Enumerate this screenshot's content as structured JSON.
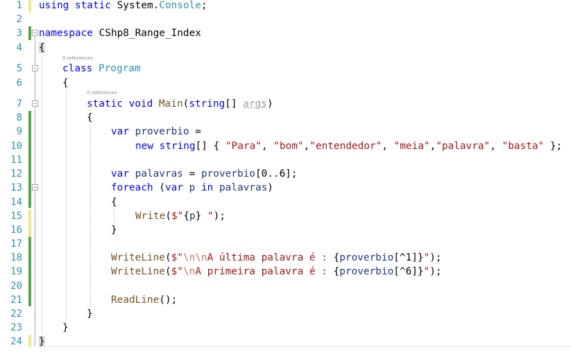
{
  "editor": {
    "line_numbers": [
      "1",
      "2",
      "3",
      "4",
      "5",
      "6",
      "7",
      "8",
      "9",
      "10",
      "11",
      "12",
      "13",
      "14",
      "15",
      "16",
      "17",
      "18",
      "19",
      "20",
      "21",
      "22",
      "23",
      "24"
    ],
    "references_label": "0 references",
    "lines": {
      "l1": {
        "a": "using static ",
        "b": "System",
        "c": ".",
        "d": "Console",
        "e": ";"
      },
      "l3": {
        "a": "namespace ",
        "b": "CShp8_Range_Index"
      },
      "l4": {
        "a": "{"
      },
      "l5": {
        "a": "class ",
        "b": "Program"
      },
      "l6": {
        "a": "{"
      },
      "l7": {
        "a": "static ",
        "b": "void ",
        "c": "Main",
        "d": "(",
        "e": "string",
        "f": "[] ",
        "g": "args",
        "h": ")"
      },
      "l8": {
        "a": "{"
      },
      "l9": {
        "a": "var ",
        "b": "proverbio",
        "c": " ="
      },
      "l10": {
        "a": "new ",
        "b": "string",
        "c": "[] { ",
        "d": "\"Para\"",
        "e": ", ",
        "f": "\"bom\"",
        "g": ",",
        "h": "\"entendedor\"",
        "i": ", ",
        "j": "\"meia\"",
        "k": ",",
        "l": "\"palavra\"",
        "m": ", ",
        "n": "\"basta\"",
        "o": " };"
      },
      "l12": {
        "a": "var ",
        "b": "palavras",
        "c": " = ",
        "d": "proverbio",
        "e": "[0..6];"
      },
      "l13": {
        "a": "foreach",
        "b": " (",
        "c": "var ",
        "d": "p",
        "e": " in ",
        "f": "palavras",
        "g": ")"
      },
      "l14": {
        "a": "{"
      },
      "l15": {
        "a": "Write",
        "b": "(",
        "c": "$\"",
        "d": "{",
        "e": "p",
        "f": "}",
        "g": " \"",
        "h": ");"
      },
      "l16": {
        "a": "}"
      },
      "l18": {
        "a": "WriteLine",
        "b": "(",
        "c": "$\"",
        "d": "\\n\\n",
        "e": "A última palavra é : ",
        "f": "{",
        "g": "proverbio",
        "h": "[^1]}",
        "i": "\"",
        "j": ");"
      },
      "l19": {
        "a": "WriteLine",
        "b": "(",
        "c": "$\"",
        "d": "\\n",
        "e": "A primeira palavra é : ",
        "f": "{",
        "g": "proverbio",
        "h": "[^6]}",
        "i": "\"",
        "j": ");"
      },
      "l21": {
        "a": "ReadLine",
        "b": "();"
      },
      "l22": {
        "a": "}"
      },
      "l23": {
        "a": "}"
      },
      "l24": {
        "a": "}"
      }
    },
    "colors": {
      "keyword": "#0000ff",
      "type": "#2b91af",
      "string": "#a31515",
      "escape": "#b97a57",
      "method": "#74531f",
      "identifier": "#1f377f",
      "line_number": "#2b91af",
      "saved_change_bar": "#57a64a",
      "unsaved_change_bar": "#f0e68c"
    },
    "icons": [
      "collapse-icon"
    ]
  }
}
